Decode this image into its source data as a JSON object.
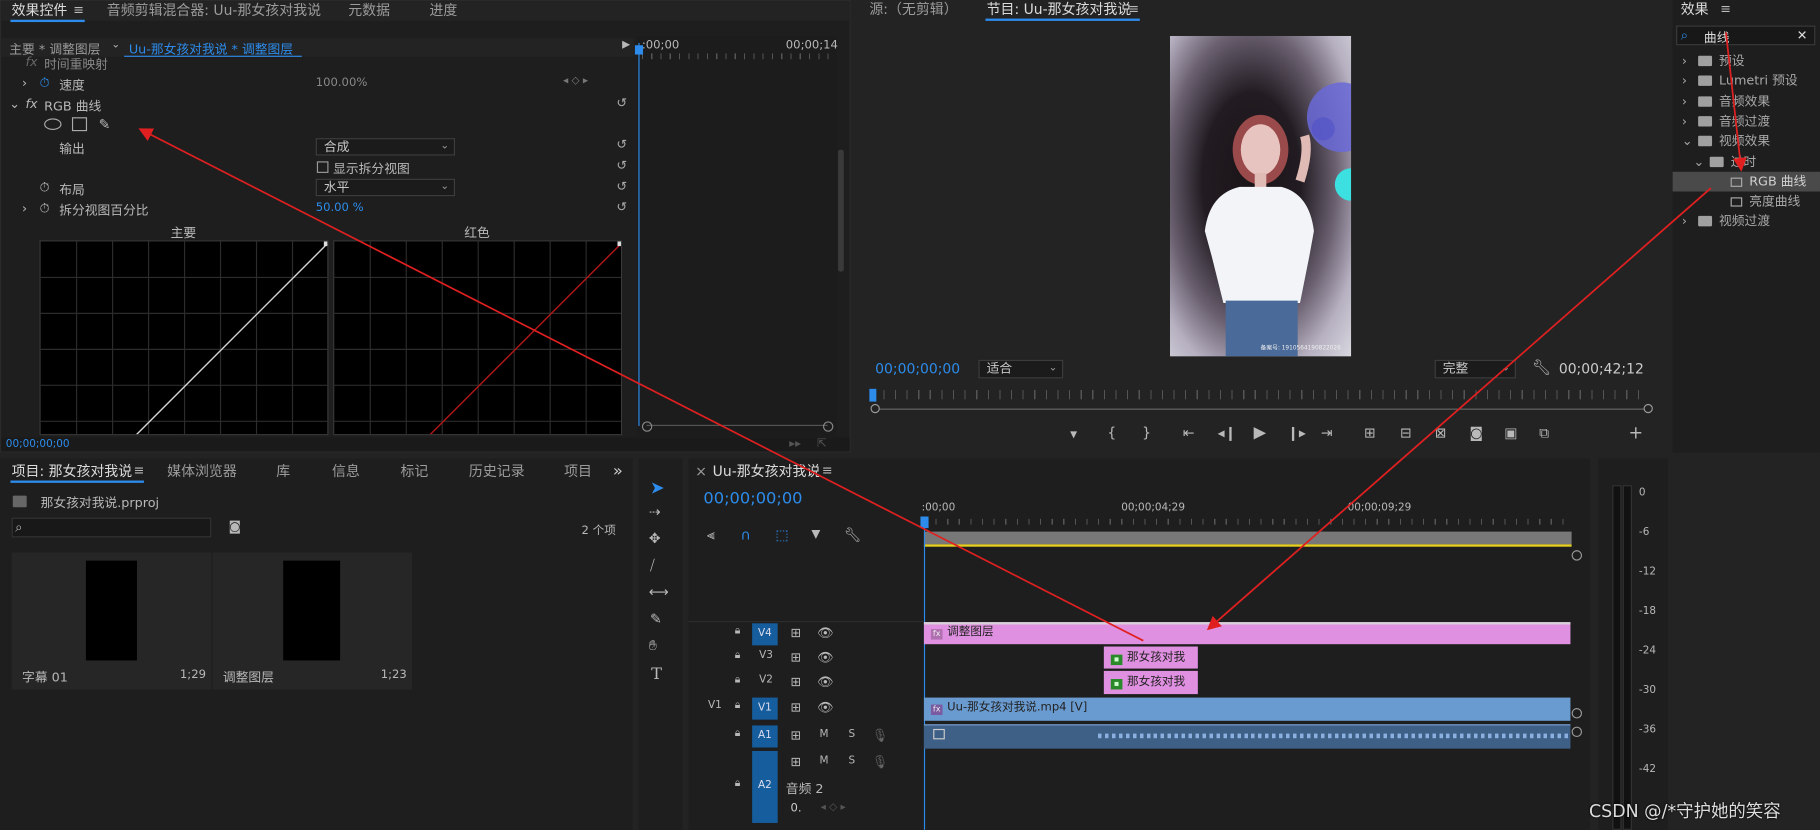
{
  "effect_controls": {
    "tabs": [
      "效果控件",
      "音频剪辑混合器: Uu-那女孩对我说",
      "元数据",
      "进度"
    ],
    "menu_glyph": "≡",
    "master_label": "主要 * 调整图层",
    "clip_label": "Uu-那女孩对我说 * 调整图层",
    "ruler_start": ":00;00",
    "ruler_end": "00;00;14",
    "time_remap": "时间重映射",
    "speed_label": "速度",
    "speed_value": "100.00%",
    "fx_name": "RGB 曲线",
    "output_label": "输出",
    "output_value": "合成",
    "split_view_label": "显示拆分视图",
    "layout_label": "布局",
    "layout_value": "水平",
    "split_pct_label": "拆分视图百分比",
    "split_pct_value": "50.00 %",
    "curve_main": "主要",
    "curve_red": "红色",
    "footer_time": "00;00;00;00"
  },
  "source_monitor": {
    "tab_source": "源:（无剪辑）",
    "tab_program": "节目: Uu-那女孩对我说",
    "timecode_current": "00;00;00;00",
    "fit_value": "适合",
    "quality_value": "完整",
    "timecode_duration": "00;00;42;12",
    "watermark": "备案号: 1910564190822026"
  },
  "effects_panel": {
    "title": "效果",
    "search_value": "曲线",
    "clear_glyph": "✕",
    "tree": [
      {
        "label": "预设",
        "level": 0,
        "expanded": false
      },
      {
        "label": "Lumetri 预设",
        "level": 0,
        "expanded": false
      },
      {
        "label": "音频效果",
        "level": 0,
        "expanded": false
      },
      {
        "label": "音频过渡",
        "level": 0,
        "expanded": false
      },
      {
        "label": "视频效果",
        "level": 0,
        "expanded": true
      },
      {
        "label": "过时",
        "level": 1,
        "expanded": true
      },
      {
        "label": "RGB 曲线",
        "level": 2,
        "selected": true
      },
      {
        "label": "亮度曲线",
        "level": 2
      },
      {
        "label": "视频过渡",
        "level": 0,
        "expanded": false
      }
    ]
  },
  "project_panel": {
    "tabs": [
      "项目: 那女孩对我说",
      "媒体浏览器",
      "库",
      "信息",
      "标记",
      "历史记录",
      "项目"
    ],
    "more_glyph": "»",
    "file_name": "那女孩对我说.prproj",
    "item_count": "2 个项",
    "items": [
      {
        "name": "字幕 01",
        "duration": "1;29"
      },
      {
        "name": "调整图层",
        "duration": "1;23"
      }
    ]
  },
  "timeline": {
    "close_glyph": "×",
    "title": "Uu-那女孩对我说",
    "timecode": "00;00;00;00",
    "ruler": [
      ":00;00",
      "00;00;04;29",
      "00;00;09;29"
    ],
    "tracks": [
      {
        "id": "V4",
        "source": ""
      },
      {
        "id": "V3",
        "source": ""
      },
      {
        "id": "V2",
        "source": ""
      },
      {
        "id": "V1",
        "source": "V1"
      },
      {
        "id": "A1",
        "source": ""
      },
      {
        "id": "A2",
        "source": ""
      }
    ],
    "a2_name": "音频 2",
    "a2_value": "0.",
    "m_label": "M",
    "s_label": "S",
    "clips": {
      "adjust": "调整图层",
      "v3": "那女孩对我",
      "v2": "那女孩对我",
      "v1": "Uu-那女孩对我说.mp4 [V]"
    }
  },
  "audio_meter": {
    "scale": [
      "0",
      "-6",
      "-12",
      "-18",
      "-24",
      "-30",
      "-36",
      "-42"
    ]
  },
  "watermark": "CSDN @/*守护她的笑容",
  "colors": {
    "accent": "#2d8ceb",
    "clip_pink": "#e090e0",
    "clip_blue": "#6a9bd0",
    "annotation": "#e02020"
  }
}
